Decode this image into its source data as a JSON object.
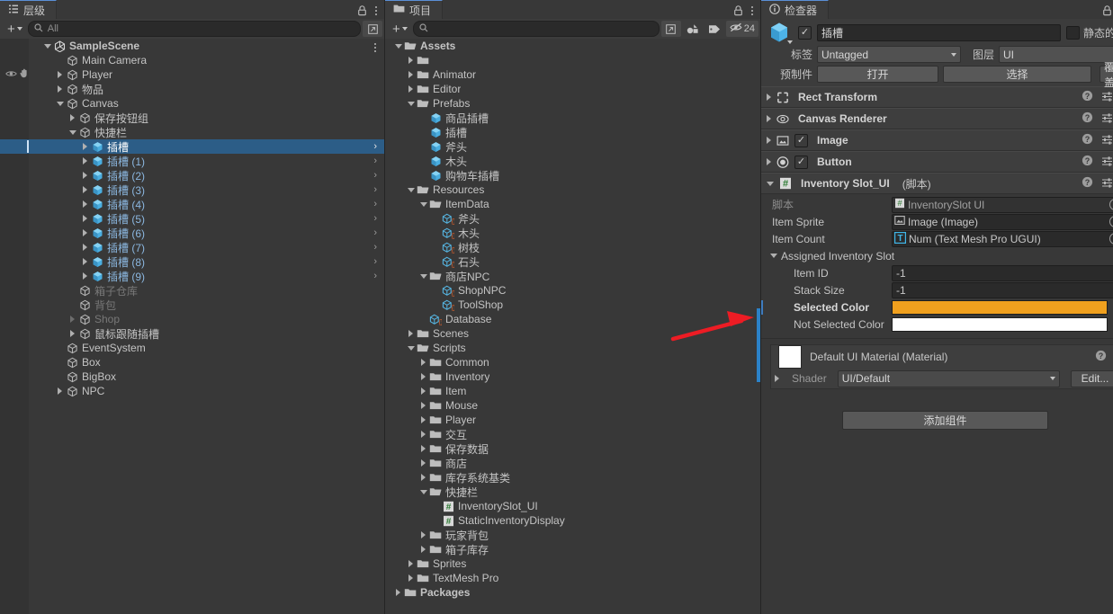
{
  "hierarchy": {
    "tab_label": "层级",
    "tab_icon": "hierarchy-icon",
    "search_placeholder": "All",
    "add_label": "+",
    "items": [
      {
        "label": "SampleScene",
        "depth": 0,
        "fold": "down",
        "icon": "unity-scene-icon",
        "bold": true,
        "kebab": true
      },
      {
        "label": "Main Camera",
        "depth": 1,
        "fold": "none",
        "icon": "gameobject-icon"
      },
      {
        "label": "Player",
        "depth": 1,
        "fold": "right",
        "icon": "gameobject-icon",
        "vis": true
      },
      {
        "label": "物品",
        "depth": 1,
        "fold": "right",
        "icon": "gameobject-icon"
      },
      {
        "label": "Canvas",
        "depth": 1,
        "fold": "down",
        "icon": "gameobject-icon"
      },
      {
        "label": "保存按钮组",
        "depth": 2,
        "fold": "right",
        "icon": "gameobject-icon"
      },
      {
        "label": "快捷栏",
        "depth": 2,
        "fold": "down",
        "icon": "gameobject-icon"
      },
      {
        "label": "插槽",
        "depth": 3,
        "fold": "right",
        "icon": "prefab-icon",
        "selected": true,
        "chev": true
      },
      {
        "label": "插槽 (1)",
        "depth": 3,
        "fold": "right",
        "icon": "prefab-icon",
        "prefab": true,
        "chev": true
      },
      {
        "label": "插槽 (2)",
        "depth": 3,
        "fold": "right",
        "icon": "prefab-icon",
        "prefab": true,
        "chev": true
      },
      {
        "label": "插槽 (3)",
        "depth": 3,
        "fold": "right",
        "icon": "prefab-icon",
        "prefab": true,
        "chev": true
      },
      {
        "label": "插槽 (4)",
        "depth": 3,
        "fold": "right",
        "icon": "prefab-icon",
        "prefab": true,
        "chev": true
      },
      {
        "label": "插槽 (5)",
        "depth": 3,
        "fold": "right",
        "icon": "prefab-icon",
        "prefab": true,
        "chev": true
      },
      {
        "label": "插槽 (6)",
        "depth": 3,
        "fold": "right",
        "icon": "prefab-icon",
        "prefab": true,
        "chev": true
      },
      {
        "label": "插槽 (7)",
        "depth": 3,
        "fold": "right",
        "icon": "prefab-icon",
        "prefab": true,
        "chev": true
      },
      {
        "label": "插槽 (8)",
        "depth": 3,
        "fold": "right",
        "icon": "prefab-icon",
        "prefab": true,
        "chev": true
      },
      {
        "label": "插槽 (9)",
        "depth": 3,
        "fold": "right",
        "icon": "prefab-icon",
        "prefab": true,
        "chev": true
      },
      {
        "label": "箱子仓库",
        "depth": 2,
        "fold": "none",
        "icon": "gameobject-icon",
        "dim": true
      },
      {
        "label": "背包",
        "depth": 2,
        "fold": "none",
        "icon": "gameobject-icon",
        "dim": true
      },
      {
        "label": "Shop",
        "depth": 2,
        "fold": "right",
        "icon": "gameobject-icon",
        "dim": true
      },
      {
        "label": "鼠标跟随插槽",
        "depth": 2,
        "fold": "right",
        "icon": "gameobject-icon"
      },
      {
        "label": "EventSystem",
        "depth": 1,
        "fold": "none",
        "icon": "gameobject-icon"
      },
      {
        "label": "Box",
        "depth": 1,
        "fold": "none",
        "icon": "gameobject-icon"
      },
      {
        "label": "BigBox",
        "depth": 1,
        "fold": "none",
        "icon": "gameobject-icon"
      },
      {
        "label": "NPC",
        "depth": 1,
        "fold": "right",
        "icon": "gameobject-icon"
      }
    ]
  },
  "project": {
    "tab_label": "项目",
    "tab_icon": "folder-icon",
    "search_placeholder": "",
    "add_label": "+",
    "hidden_count": "24",
    "toolbar_icons": [
      "search-in-window-icon",
      "asset-type-filter-icon",
      "label-filter-icon",
      "hidden-items-icon"
    ],
    "items": [
      {
        "label": "Assets",
        "depth": 0,
        "fold": "down",
        "icon": "folder-open-icon",
        "bold": true
      },
      {
        "label": "",
        "depth": 1,
        "fold": "right",
        "icon": "folder-icon"
      },
      {
        "label": "Animator",
        "depth": 1,
        "fold": "right",
        "icon": "folder-icon"
      },
      {
        "label": "Editor",
        "depth": 1,
        "fold": "right",
        "icon": "folder-icon"
      },
      {
        "label": "Prefabs",
        "depth": 1,
        "fold": "down",
        "icon": "folder-open-icon"
      },
      {
        "label": "商品插槽",
        "depth": 2,
        "fold": "none",
        "icon": "prefab-icon"
      },
      {
        "label": "插槽",
        "depth": 2,
        "fold": "none",
        "icon": "prefab-icon"
      },
      {
        "label": "斧头",
        "depth": 2,
        "fold": "none",
        "icon": "prefab-icon"
      },
      {
        "label": "木头",
        "depth": 2,
        "fold": "none",
        "icon": "prefab-icon"
      },
      {
        "label": "购物车插槽",
        "depth": 2,
        "fold": "none",
        "icon": "prefab-icon"
      },
      {
        "label": "Resources",
        "depth": 1,
        "fold": "down",
        "icon": "folder-open-icon"
      },
      {
        "label": "ItemData",
        "depth": 2,
        "fold": "down",
        "icon": "folder-open-icon"
      },
      {
        "label": "斧头",
        "depth": 3,
        "fold": "none",
        "icon": "scriptable-object-icon"
      },
      {
        "label": "木头",
        "depth": 3,
        "fold": "none",
        "icon": "scriptable-object-icon"
      },
      {
        "label": "树枝",
        "depth": 3,
        "fold": "none",
        "icon": "scriptable-object-icon"
      },
      {
        "label": "石头",
        "depth": 3,
        "fold": "none",
        "icon": "scriptable-object-icon"
      },
      {
        "label": "商店NPC",
        "depth": 2,
        "fold": "down",
        "icon": "folder-open-icon"
      },
      {
        "label": "ShopNPC",
        "depth": 3,
        "fold": "none",
        "icon": "scriptable-object-icon"
      },
      {
        "label": "ToolShop",
        "depth": 3,
        "fold": "none",
        "icon": "scriptable-object-icon"
      },
      {
        "label": "Database",
        "depth": 2,
        "fold": "none",
        "icon": "scriptable-object-icon"
      },
      {
        "label": "Scenes",
        "depth": 1,
        "fold": "right",
        "icon": "folder-icon"
      },
      {
        "label": "Scripts",
        "depth": 1,
        "fold": "down",
        "icon": "folder-open-icon"
      },
      {
        "label": "Common",
        "depth": 2,
        "fold": "right",
        "icon": "folder-icon"
      },
      {
        "label": "Inventory",
        "depth": 2,
        "fold": "right",
        "icon": "folder-icon"
      },
      {
        "label": "Item",
        "depth": 2,
        "fold": "right",
        "icon": "folder-icon"
      },
      {
        "label": "Mouse",
        "depth": 2,
        "fold": "right",
        "icon": "folder-icon"
      },
      {
        "label": "Player",
        "depth": 2,
        "fold": "right",
        "icon": "folder-icon"
      },
      {
        "label": "交互",
        "depth": 2,
        "fold": "right",
        "icon": "folder-icon"
      },
      {
        "label": "保存数据",
        "depth": 2,
        "fold": "right",
        "icon": "folder-icon"
      },
      {
        "label": "商店",
        "depth": 2,
        "fold": "right",
        "icon": "folder-icon"
      },
      {
        "label": "库存系统基类",
        "depth": 2,
        "fold": "right",
        "icon": "folder-icon"
      },
      {
        "label": "快捷栏",
        "depth": 2,
        "fold": "down",
        "icon": "folder-open-icon"
      },
      {
        "label": "InventorySlot_UI",
        "depth": 3,
        "fold": "none",
        "icon": "csharp-script-icon"
      },
      {
        "label": "StaticInventoryDisplay",
        "depth": 3,
        "fold": "none",
        "icon": "csharp-script-icon"
      },
      {
        "label": "玩家背包",
        "depth": 2,
        "fold": "right",
        "icon": "folder-icon"
      },
      {
        "label": "箱子库存",
        "depth": 2,
        "fold": "right",
        "icon": "folder-icon"
      },
      {
        "label": "Sprites",
        "depth": 1,
        "fold": "right",
        "icon": "folder-icon"
      },
      {
        "label": "TextMesh Pro",
        "depth": 1,
        "fold": "right",
        "icon": "folder-icon"
      },
      {
        "label": "Packages",
        "depth": 0,
        "fold": "right",
        "icon": "folder-icon",
        "bold": true
      }
    ]
  },
  "inspector": {
    "tab_label": "检查器",
    "tab_icon": "info-icon",
    "object_name": "插槽",
    "active_checked": true,
    "static_label": "静态的",
    "tag_label": "标签",
    "tag_value": "Untagged",
    "layer_label": "图层",
    "layer_value": "UI",
    "prefab_label": "预制件",
    "prefab_open": "打开",
    "prefab_select": "选择",
    "prefab_overrides": "覆盖",
    "components": [
      {
        "name": "Rect Transform",
        "icon": "rect-transform-icon",
        "fold": "right",
        "toggle": false
      },
      {
        "name": "Canvas Renderer",
        "icon": "canvas-renderer-icon",
        "fold": "right",
        "toggle": false
      },
      {
        "name": "Image",
        "icon": "image-component-icon",
        "fold": "right",
        "toggle": true
      },
      {
        "name": "Button",
        "icon": "button-component-icon",
        "fold": "right",
        "toggle": true
      },
      {
        "name": "Inventory Slot_UI",
        "suffix": "(脚本)",
        "icon": "csharp-script-icon",
        "fold": "down",
        "toggle": false
      }
    ],
    "script_field": {
      "label": "脚本",
      "value": "InventorySlot UI",
      "icon": "csharp-script-icon"
    },
    "fields": [
      {
        "label": "Item Sprite",
        "value": "Image (Image)",
        "icon": "image-ref-icon",
        "type": "object"
      },
      {
        "label": "Item Count",
        "value": "Num (Text Mesh Pro UGUI)",
        "icon": "tmp-icon",
        "type": "object"
      }
    ],
    "assigned_slot_header": "Assigned Inventory Slot",
    "assigned_fields": [
      {
        "label": "Item ID",
        "value": "-1",
        "type": "number"
      },
      {
        "label": "Stack Size",
        "value": "-1",
        "type": "number"
      }
    ],
    "color_fields": [
      {
        "label": "Selected Color",
        "color": "#f0a01e",
        "bold": true,
        "override": true
      },
      {
        "label": "Not Selected Color",
        "color": "#ffffff",
        "bold": false,
        "override": false
      }
    ],
    "material": {
      "title": "Default UI Material (Material)",
      "swatch": "#ffffff",
      "shader_label": "Shader",
      "shader_value": "UI/Default",
      "edit_label": "Edit..."
    },
    "add_component_label": "添加组件"
  },
  "annotation": {
    "type": "red-arrow",
    "color": "#ed1c24"
  },
  "colors": {
    "panel_bg": "#383838",
    "row_alt": "#3f3f3f",
    "selection": "#2c5d87",
    "accent_blue": "#2b81c8",
    "prefab_blue": "#8bb7e0",
    "selected_color": "#f0a01e"
  }
}
